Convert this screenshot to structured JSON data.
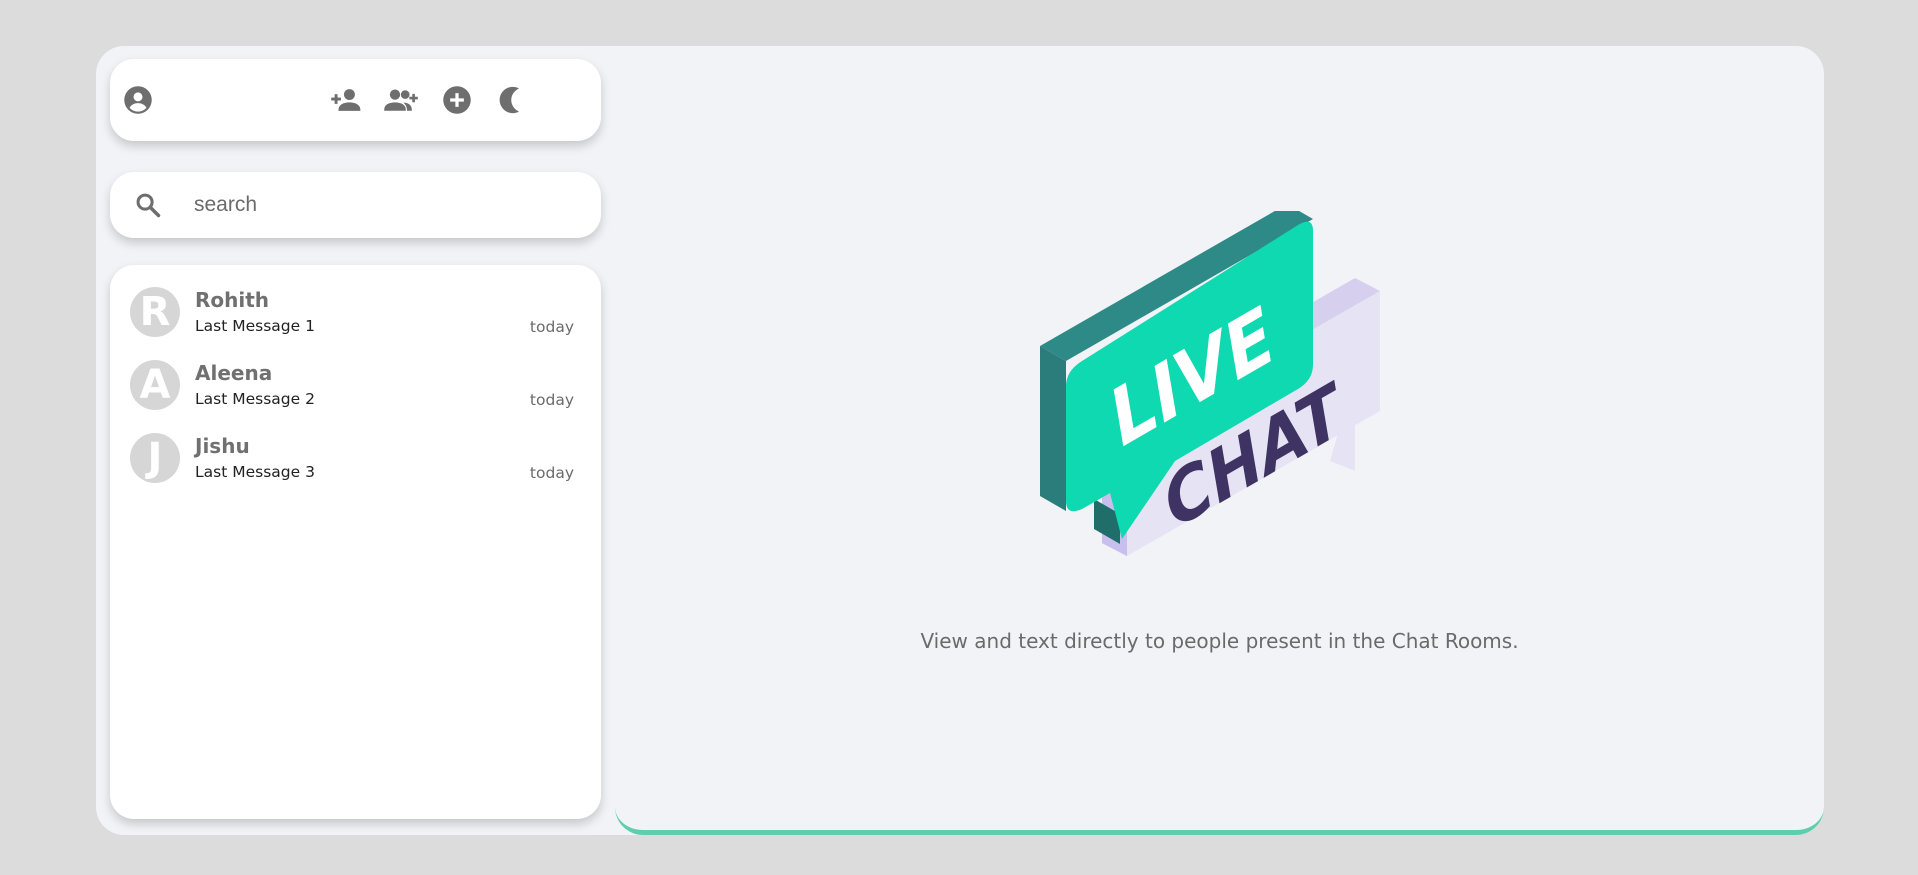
{
  "toolbar": {
    "icons": [
      "profile-icon",
      "add-contact-icon",
      "add-group-icon",
      "add-circle-icon",
      "dark-mode-icon"
    ]
  },
  "search": {
    "placeholder": "search",
    "value": ""
  },
  "chats": [
    {
      "initial": "R",
      "name": "Rohith",
      "last_message": "Last Message 1",
      "time": "today"
    },
    {
      "initial": "A",
      "name": "Aleena",
      "last_message": "Last Message 2",
      "time": "today"
    },
    {
      "initial": "J",
      "name": "Jishu",
      "last_message": "Last Message 3",
      "time": "today"
    }
  ],
  "main": {
    "logo_words": [
      "LIVE",
      "CHAT"
    ],
    "tagline": "View and text directly to people present in the Chat Rooms."
  },
  "colors": {
    "page_bg": "#dcdcdc",
    "panel_bg": "#f2f3f7",
    "accent": "#5dcfad",
    "live_bubble": "#0fd9b0",
    "chat_bubble": "#e6e3f5",
    "chat_text": "#3e3363",
    "icon_gray": "#6e6e6e"
  }
}
